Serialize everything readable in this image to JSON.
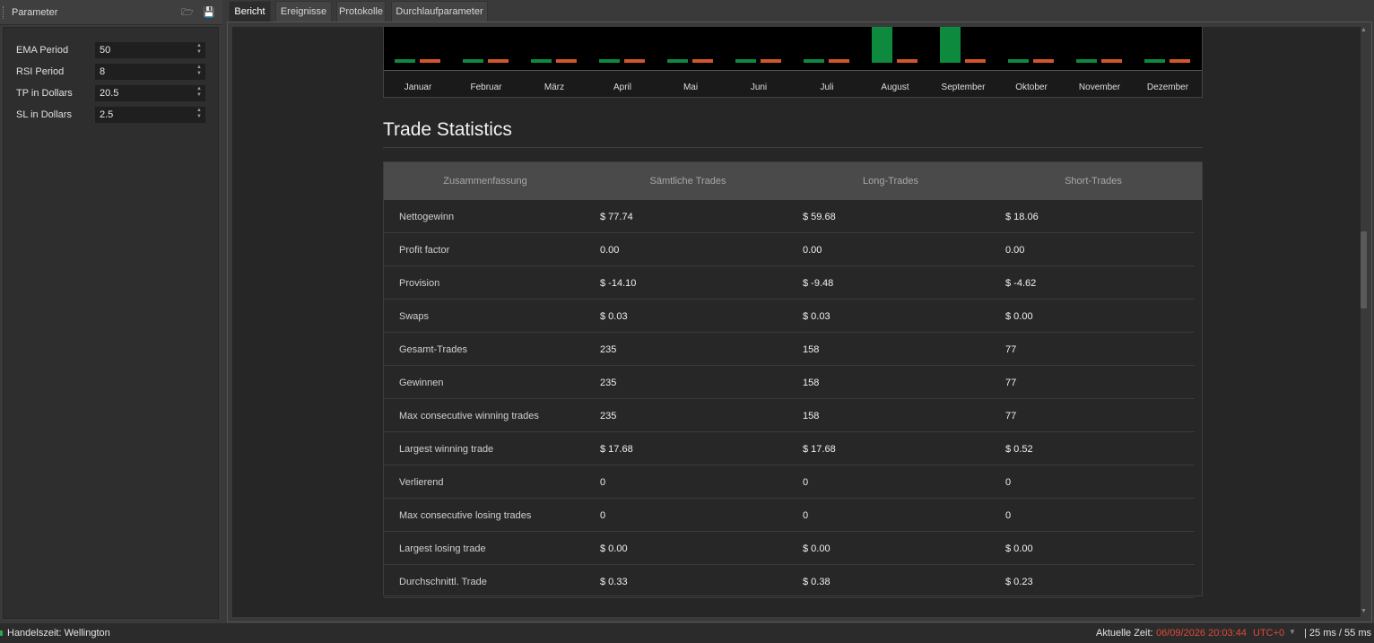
{
  "parameters": {
    "title": "Parameter",
    "items": [
      {
        "label": "EMA Period",
        "value": "50"
      },
      {
        "label": "RSI Period",
        "value": "8"
      },
      {
        "label": "TP in Dollars",
        "value": "20.5"
      },
      {
        "label": "SL in Dollars",
        "value": "2.5"
      }
    ]
  },
  "tabs": [
    {
      "label": "Bericht",
      "active": true
    },
    {
      "label": "Ereignisse",
      "active": false
    },
    {
      "label": "Protokolle",
      "active": false
    },
    {
      "label": "Durchlaufparameter",
      "active": false
    }
  ],
  "chart_data": {
    "type": "bar",
    "categories": [
      "Januar",
      "Februar",
      "März",
      "April",
      "Mai",
      "Juni",
      "Juli",
      "August",
      "September",
      "Oktober",
      "November",
      "Dezember"
    ],
    "series": [
      {
        "color": "#0e8a3e",
        "values": [
          0.1,
          0.1,
          0.1,
          0.1,
          0.1,
          0.1,
          0.1,
          1.0,
          1.0,
          0.1,
          0.1,
          0.1
        ]
      },
      {
        "color": "#d2552c",
        "values": [
          0.1,
          0.1,
          0.1,
          0.1,
          0.1,
          0.1,
          0.1,
          0.1,
          0.1,
          0.1,
          0.1,
          0.1
        ]
      }
    ]
  },
  "trade_statistics": {
    "title": "Trade Statistics",
    "columns": [
      "Zusammenfassung",
      "Sämtliche Trades",
      "Long-Trades",
      "Short-Trades"
    ],
    "rows": [
      [
        "Nettogewinn",
        "$ 77.74",
        "$ 59.68",
        "$ 18.06"
      ],
      [
        "Profit factor",
        "0.00",
        "0.00",
        "0.00"
      ],
      [
        "Provision",
        "$ -14.10",
        "$ -9.48",
        "$ -4.62"
      ],
      [
        "Swaps",
        "$ 0.03",
        "$ 0.03",
        "$ 0.00"
      ],
      [
        "Gesamt-Trades",
        "235",
        "158",
        "77"
      ],
      [
        "Gewinnen",
        "235",
        "158",
        "77"
      ],
      [
        "Max consecutive winning trades",
        "235",
        "158",
        "77"
      ],
      [
        "Largest winning trade",
        "$ 17.68",
        "$ 17.68",
        "$ 0.52"
      ],
      [
        "Verlierend",
        "0",
        "0",
        "0"
      ],
      [
        "Max consecutive losing trades",
        "0",
        "0",
        "0"
      ],
      [
        "Largest losing trade",
        "$ 0.00",
        "$ 0.00",
        "$ 0.00"
      ],
      [
        "Durchschnittl. Trade",
        "$ 0.33",
        "$ 0.38",
        "$ 0.23"
      ]
    ]
  },
  "status": {
    "trading_time": "Handelszeit: Wellington",
    "current_time_label": "Aktuelle Zeit:",
    "current_time": "06/09/2026 20:03:44",
    "timezone": "UTC+0",
    "latency": "| 25 ms / 55 ms"
  },
  "colors": {
    "positive": "#0e8a3e",
    "negative": "#d2552c",
    "status_time": "#e04a3a"
  }
}
